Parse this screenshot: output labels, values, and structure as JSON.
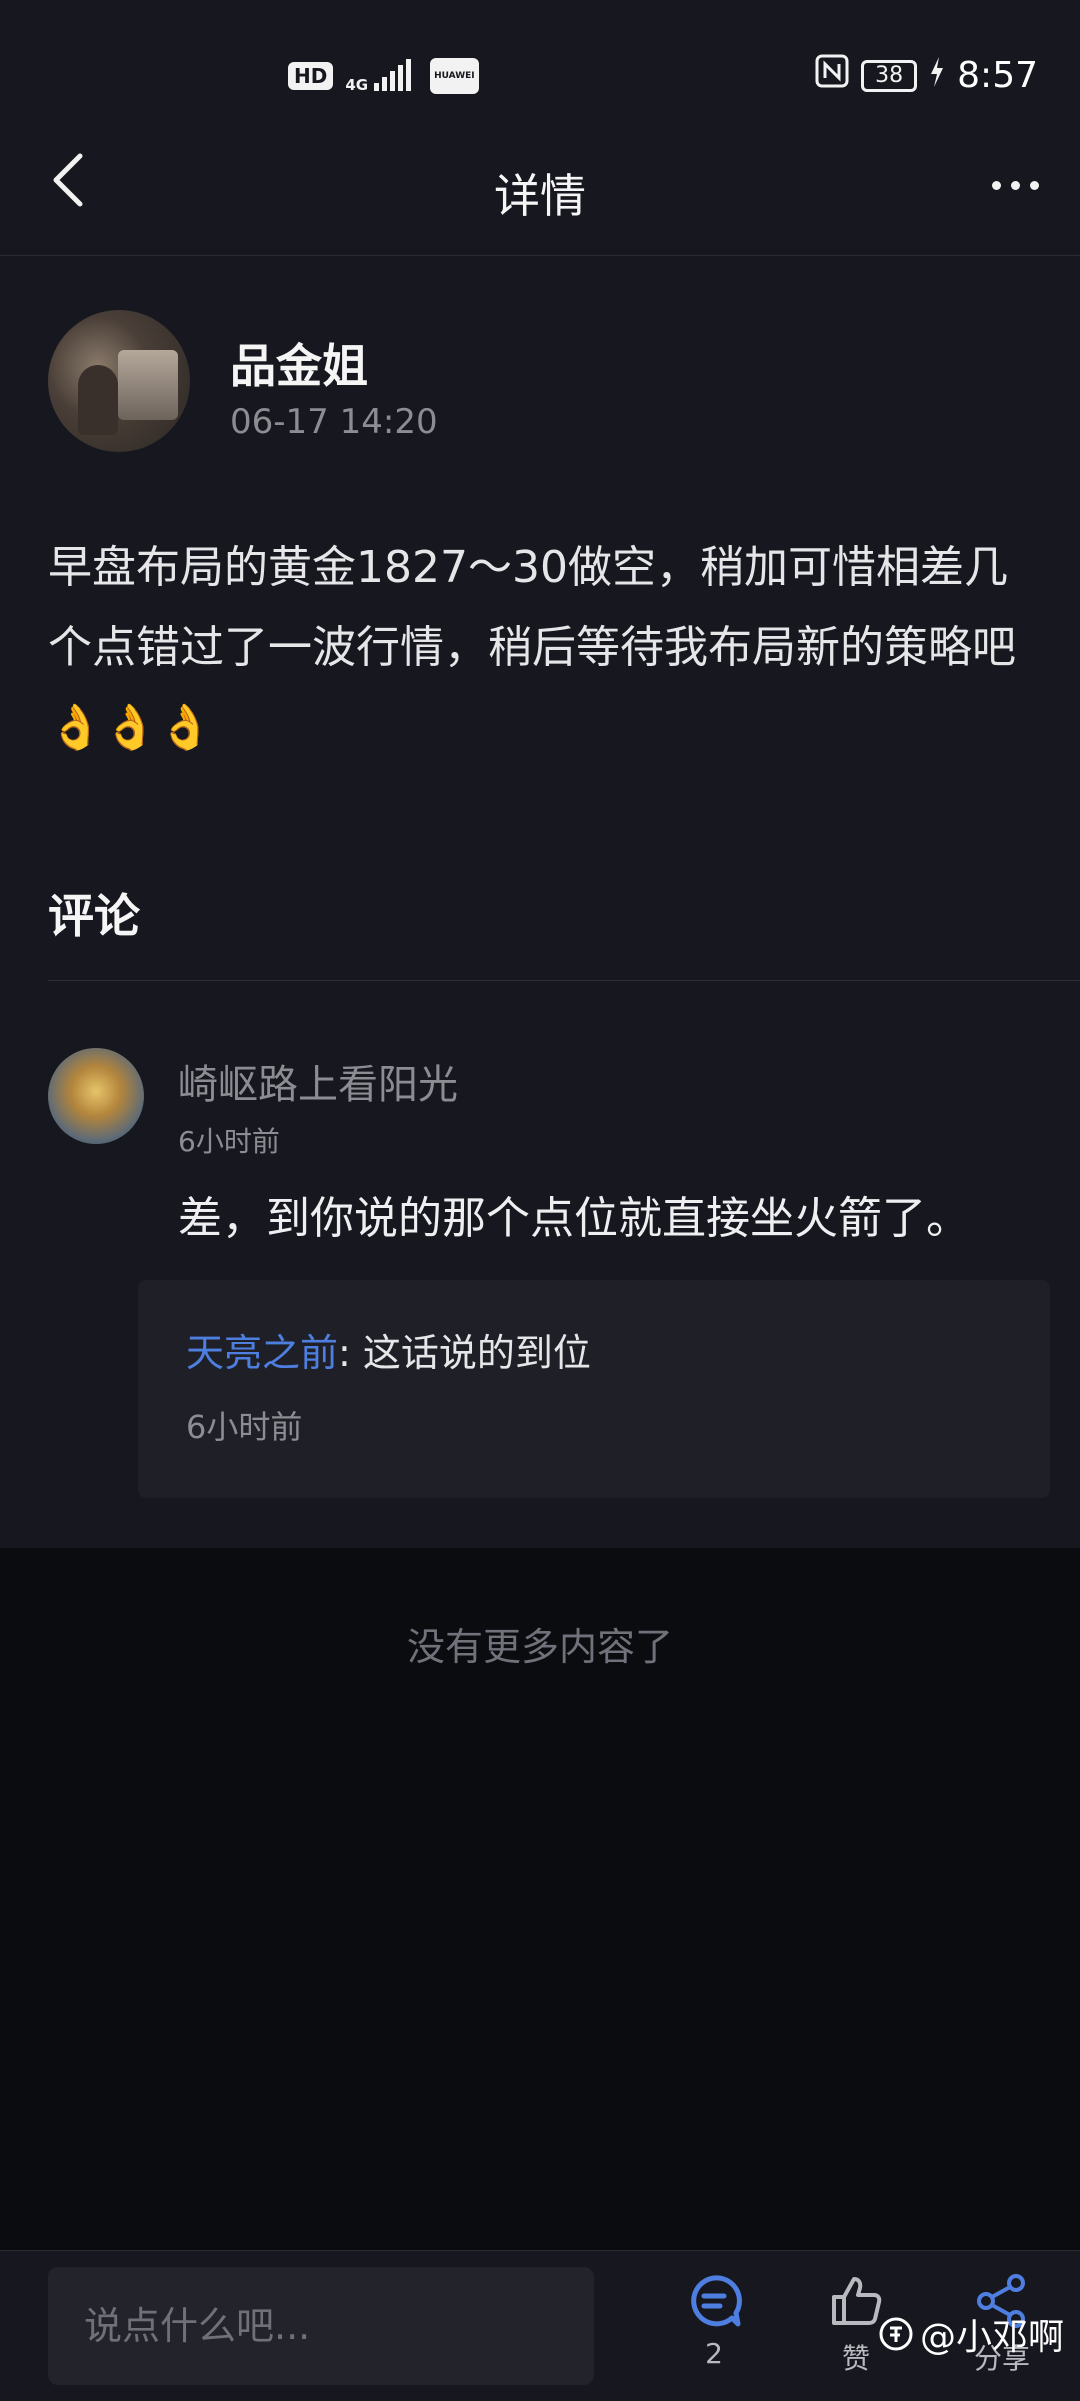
{
  "status_bar": {
    "hd": "HD",
    "network": "4G",
    "brand": "HUAWEI",
    "battery": "38",
    "time": "8:57"
  },
  "nav": {
    "title": "详情"
  },
  "post": {
    "author": "品金姐",
    "time": "06-17 14:20",
    "content": "早盘布局的黄金1827～30做空，稍加可惜相差几个点错过了一波行情，稍后等待我布局新的策略吧👌👌👌"
  },
  "comments_section": {
    "heading": "评论"
  },
  "comment": {
    "author": "崎岖路上看阳光",
    "time": "6小时前",
    "text": "差，到你说的那个点位就直接坐火箭了。",
    "reply": {
      "user": "天亮之前",
      "separator": ": ",
      "text": "这话说的到位",
      "time": "6小时前"
    }
  },
  "footer": {
    "no_more": "没有更多内容了"
  },
  "bottom_bar": {
    "input_placeholder": "说点什么吧...",
    "comment_count": "2",
    "like_label": "赞",
    "share_label": "分享",
    "accent": "#4e7fe0"
  },
  "watermark": "@小邓啊"
}
